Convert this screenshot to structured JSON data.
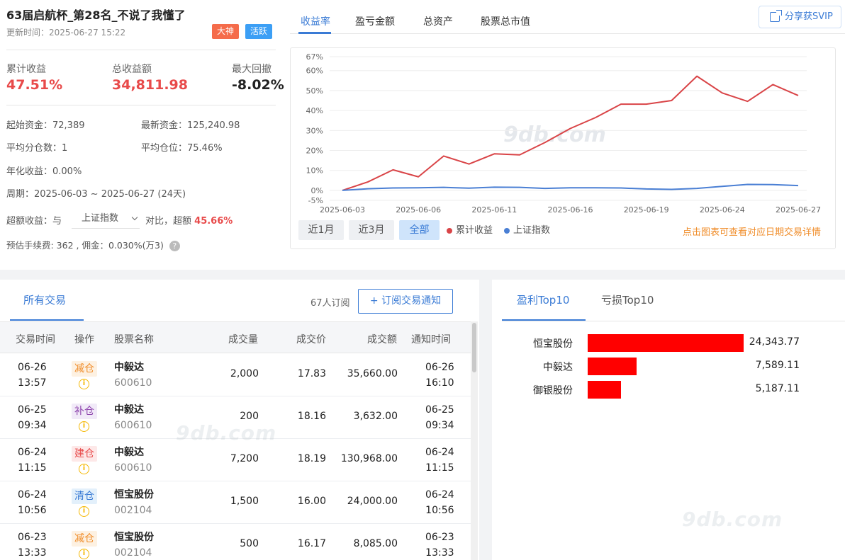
{
  "header": {
    "title": "63届启航杯_第28名_不说了我懂了",
    "update_time": "更新时间：2025-06-27 15:22",
    "tags": [
      "大神",
      "活跃"
    ]
  },
  "stats": [
    {
      "label": "累计收益",
      "value": "47.51%"
    },
    {
      "label": "总收益额",
      "value": "34,811.98"
    },
    {
      "label": "最大回撤",
      "value": "-8.02%"
    }
  ],
  "info": {
    "start_capital": "起始资金：72,389",
    "latest_capital": "最新资金：125,240.98",
    "avg_splits": "平均分仓数：1",
    "avg_position": "平均仓位：75.46%",
    "annual_return": "年化收益：0.00%",
    "period": "周期：2025-06-03 ~ 2025-06-27 (24天)",
    "excess_prefix": "超额收益：与",
    "benchmark": "上证指数",
    "excess_middle": "对比，超额",
    "excess_value": "45.66%",
    "fee": "预估手续费: 362 , 佣金：0.030%(万3)",
    "help": "?"
  },
  "top_tabs": [
    "收益率",
    "盈亏金额",
    "总资产",
    "股票总市值"
  ],
  "share_button": "分享获SVIP",
  "range_buttons": [
    "近1月",
    "近3月",
    "全部"
  ],
  "legend": [
    "累计收益",
    "上证指数"
  ],
  "hint": "点击图表可查看对应日期交易详情",
  "watermark": "9db.com",
  "colors": {
    "cumulative": "#d94447",
    "index": "#4a7fd4",
    "accent": "#3a7bd5"
  },
  "chart_data": {
    "type": "line",
    "x": [
      "2025-06-03",
      "2025-06-05",
      "2025-06-06",
      "2025-06-09",
      "2025-06-10",
      "2025-06-11",
      "2025-06-12",
      "2025-06-13",
      "2025-06-16",
      "2025-06-17",
      "2025-06-18",
      "2025-06-19",
      "2025-06-20",
      "2025-06-23",
      "2025-06-24",
      "2025-06-25",
      "2025-06-26",
      "2025-06-27"
    ],
    "x_ticks": [
      "2025-06-03",
      "2025-06-06",
      "2025-06-11",
      "2025-06-16",
      "2025-06-19",
      "2025-06-24",
      "2025-06-27"
    ],
    "y_ticks": [
      "67%",
      "60%",
      "50%",
      "40%",
      "30%",
      "20%",
      "10%",
      "0%",
      "-5%"
    ],
    "ylim": [
      -5,
      67
    ],
    "series": [
      {
        "name": "累计收益",
        "values": [
          0,
          4.2,
          10.3,
          6.8,
          17.2,
          13.2,
          18.3,
          17.8,
          24,
          31,
          36.5,
          43.2,
          43.2,
          45,
          57.2,
          48.8,
          44.6,
          53,
          47.5
        ]
      },
      {
        "name": "上证指数",
        "values": [
          0,
          0.8,
          1.2,
          1.3,
          1.5,
          1.1,
          1.6,
          1.5,
          1.0,
          1.3,
          1.3,
          1.2,
          0.7,
          0.5,
          1.0,
          2.0,
          3.0,
          2.9,
          2.4
        ]
      }
    ]
  },
  "trades": {
    "tab": "所有交易",
    "subs_count": "67人订阅",
    "subs_button": "+ 订阅交易通知",
    "columns": [
      "交易时间",
      "操作",
      "股票名称",
      "成交量",
      "成交价",
      "成交额",
      "通知时间"
    ],
    "rows": [
      {
        "date": "06-26",
        "time": "13:57",
        "op": "减仓",
        "op_type": "jian",
        "name": "中毅达",
        "code": "600610",
        "qty": "2,000",
        "price": "17.83",
        "amount": "35,660.00",
        "ndate": "06-26",
        "ntime": "16:10"
      },
      {
        "date": "06-25",
        "time": "09:34",
        "op": "补仓",
        "op_type": "bu",
        "name": "中毅达",
        "code": "600610",
        "qty": "200",
        "price": "18.16",
        "amount": "3,632.00",
        "ndate": "06-25",
        "ntime": "09:34"
      },
      {
        "date": "06-24",
        "time": "11:15",
        "op": "建仓",
        "op_type": "jian2",
        "name": "中毅达",
        "code": "600610",
        "qty": "7,200",
        "price": "18.19",
        "amount": "130,968.00",
        "ndate": "06-24",
        "ntime": "11:15"
      },
      {
        "date": "06-24",
        "time": "10:56",
        "op": "清仓",
        "op_type": "qing",
        "name": "恒宝股份",
        "code": "002104",
        "qty": "1,500",
        "price": "16.00",
        "amount": "24,000.00",
        "ndate": "06-24",
        "ntime": "10:56"
      },
      {
        "date": "06-23",
        "time": "13:33",
        "op": "减仓",
        "op_type": "jian",
        "name": "恒宝股份",
        "code": "002104",
        "qty": "500",
        "price": "16.17",
        "amount": "8,085.00",
        "ndate": "06-23",
        "ntime": "13:33"
      }
    ]
  },
  "top10": {
    "tabs": [
      "盈利Top10",
      "亏损Top10"
    ],
    "items": [
      {
        "name": "恒宝股份",
        "value": "24,343.77",
        "num": 24343.77
      },
      {
        "name": "中毅达",
        "value": "7,589.11",
        "num": 7589.11
      },
      {
        "name": "御银股份",
        "value": "5,187.11",
        "num": 5187.11
      }
    ]
  }
}
